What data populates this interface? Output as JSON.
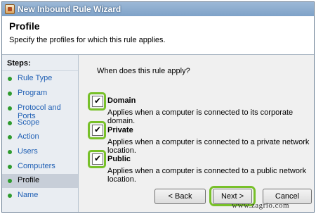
{
  "window": {
    "title": "New Inbound Rule Wizard",
    "icon": "firewall-icon"
  },
  "header": {
    "title": "Profile",
    "subtitle": "Specify the profiles for which this rule applies."
  },
  "sidebar": {
    "title": "Steps:",
    "items": [
      {
        "label": "Rule Type"
      },
      {
        "label": "Program"
      },
      {
        "label": "Protocol and Ports"
      },
      {
        "label": "Scope"
      },
      {
        "label": "Action"
      },
      {
        "label": "Users"
      },
      {
        "label": "Computers"
      },
      {
        "label": "Profile"
      },
      {
        "label": "Name"
      }
    ],
    "current": "Profile"
  },
  "main": {
    "question": "When does this rule apply?",
    "options": [
      {
        "label": "Domain",
        "description": "Applies when a computer is connected to its corporate domain.",
        "checked": true
      },
      {
        "label": "Private",
        "description": "Applies when a computer is connected to a private network location.",
        "checked": true
      },
      {
        "label": "Public",
        "description": "Applies when a computer is connected to a public network location.",
        "checked": true
      }
    ]
  },
  "buttons": {
    "back": "< Back",
    "next": "Next >",
    "cancel": "Cancel"
  },
  "colors": {
    "highlight": "#78c02a",
    "link": "#1f5fb4",
    "bullet": "#2e9b2e"
  },
  "watermark": "www.zagrio.com"
}
